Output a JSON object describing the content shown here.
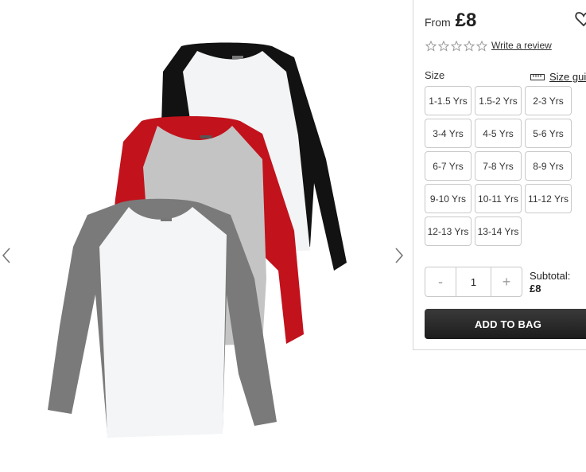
{
  "gallery": {
    "image_icon": "product-image",
    "prev_icon": "chevron-left-icon",
    "next_icon": "chevron-right-icon"
  },
  "product": {
    "price_prefix": "From",
    "price": "£8",
    "rating_stars": 0,
    "review_link": "Write a review",
    "size_label": "Size",
    "size_guide": "Size guid",
    "sizes": [
      "1-1.5 Yrs",
      "1.5-2 Yrs",
      "2-3 Yrs",
      "3-4 Yrs",
      "4-5 Yrs",
      "5-6 Yrs",
      "6-7 Yrs",
      "7-8 Yrs",
      "8-9 Yrs",
      "9-10 Yrs",
      "10-11 Yrs",
      "11-12 Yrs",
      "12-13 Yrs",
      "13-14 Yrs"
    ],
    "quantity": {
      "minus": "-",
      "value": "1",
      "plus": "+"
    },
    "subtotal_label": "Subtotal:",
    "subtotal_value": "£8",
    "add_to_bag": "ADD TO BAG"
  },
  "colors": {
    "button_dark": "#232323",
    "border": "#c9c9c9",
    "tshirt_black": "#111111",
    "tshirt_red": "#c2121c",
    "tshirt_grey": "#8a8a8a"
  }
}
